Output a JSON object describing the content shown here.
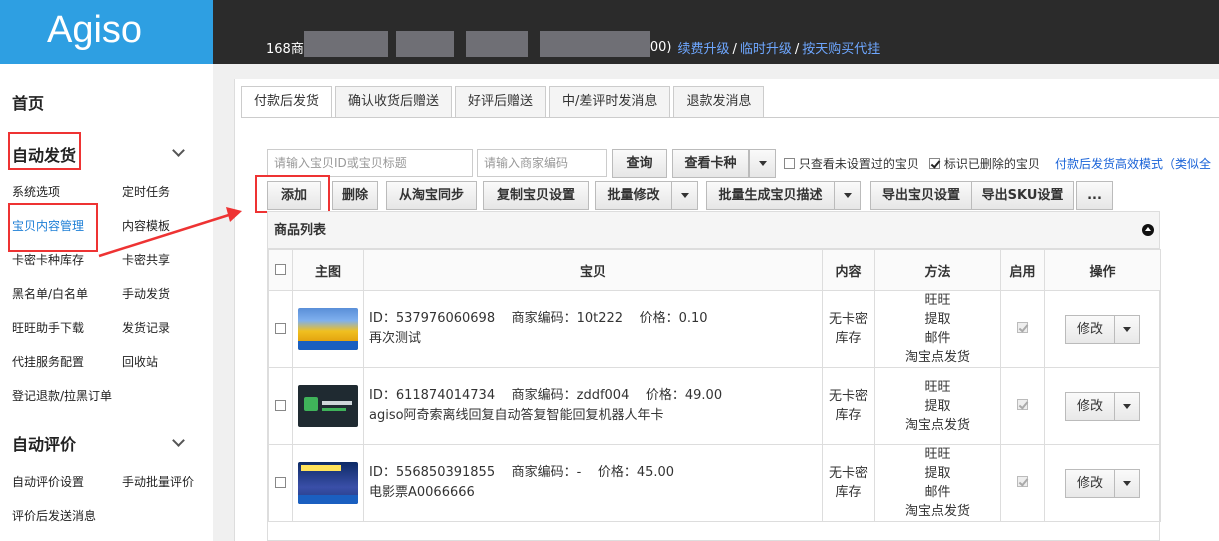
{
  "brand": {
    "logo_text": "Agiso"
  },
  "topbar": {
    "account_prefix": "168商",
    "account_suffix": "00)",
    "links": [
      "续费升级",
      "临时升级",
      "按天购买代挂"
    ],
    "separator": "/"
  },
  "sidebar": {
    "home": "首页",
    "sections": [
      {
        "title": "自动发货",
        "items": [
          "系统选项",
          "定时任务",
          "宝贝内容管理",
          "内容模板",
          "卡密卡种库存",
          "卡密共享",
          "黑名单/白名单",
          "手动发货",
          "旺旺助手下载",
          "发货记录",
          "代挂服务配置",
          "回收站",
          "登记退款/拉黑订单"
        ]
      },
      {
        "title": "自动评价",
        "items": [
          "自动评价设置",
          "手动批量评价",
          "评价后发送消息"
        ]
      }
    ],
    "active_item": "宝贝内容管理"
  },
  "tabs": [
    "付款后发货",
    "确认收货后赠送",
    "好评后赠送",
    "中/差评时发消息",
    "退款发消息"
  ],
  "active_tab": 0,
  "search": {
    "item_placeholder": "请输入宝贝ID或宝贝标题",
    "code_placeholder": "请输入商家编码",
    "query_label": "查询",
    "view_card_label": "查看卡种"
  },
  "filters": {
    "only_unset_label": "只查看未设置过的宝贝",
    "only_unset_checked": false,
    "mark_deleted_label": "标识已删除的宝贝",
    "mark_deleted_checked": true,
    "mode_link": "付款后发货高效模式（类似全"
  },
  "toolbar": {
    "add": "添加",
    "delete": "删除",
    "sync": "从淘宝同步",
    "copy": "复制宝贝设置",
    "batch_edit": "批量修改",
    "batch_desc": "批量生成宝贝描述",
    "export_items": "导出宝贝设置",
    "export_sku": "导出SKU设置",
    "more": "..."
  },
  "product_list": {
    "title": "商品列表",
    "columns": [
      "主图",
      "宝贝",
      "内容",
      "方法",
      "启用",
      "操作"
    ],
    "rows": [
      {
        "id_text": "ID：537976060698    商家编码：10t222    价格：0.10",
        "title": "再次测试",
        "content": [
          "无卡密",
          "库存"
        ],
        "methods": [
          "旺旺",
          "提取",
          "邮件",
          "淘宝点发货"
        ],
        "enabled": true,
        "action": "修改",
        "thumb": "flowers-image"
      },
      {
        "id_text": "ID：611874014734    商家编码：zddf004    价格：49.00",
        "title": "agiso阿奇索离线回复自动答复智能回复机器人年卡",
        "content": [
          "无卡密",
          "库存"
        ],
        "methods": [
          "旺旺",
          "提取",
          "淘宝点发货"
        ],
        "enabled": true,
        "action": "修改",
        "thumb": "agiso-logo-image"
      },
      {
        "id_text": "ID：556850391855    商家编码：-    价格：45.00",
        "title": "电影票A0066666",
        "content": [
          "无卡密",
          "库存"
        ],
        "methods": [
          "旺旺",
          "提取",
          "邮件",
          "淘宝点发货"
        ],
        "enabled": true,
        "action": "修改",
        "thumb": "cinema-image"
      }
    ]
  },
  "colors": {
    "brand_blue": "#2e9fe2",
    "topbar": "#2b2b2b",
    "highlight_red": "#e33333",
    "link_blue": "#1a63d8"
  }
}
